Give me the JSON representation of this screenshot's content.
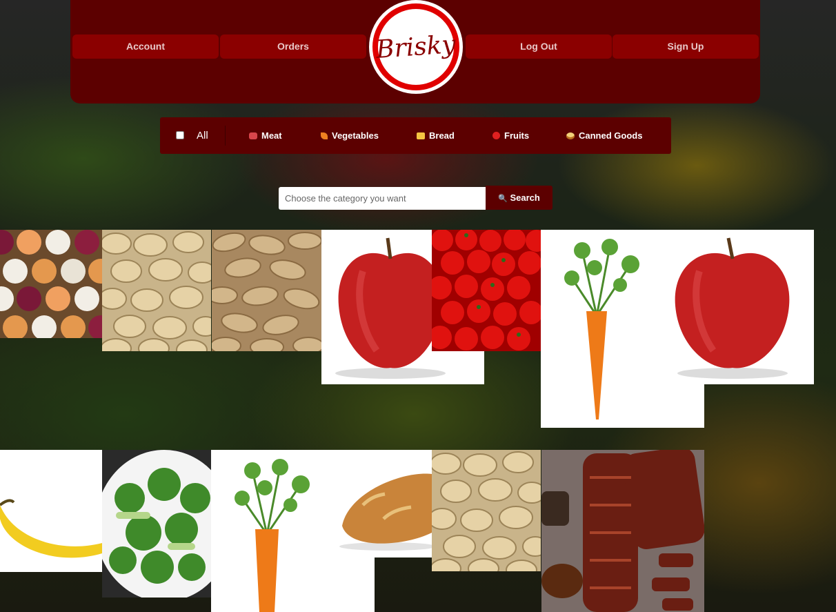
{
  "header": {
    "logo_text": "Brisky",
    "nav": {
      "account": "Account",
      "orders": "Orders",
      "logout": "Log Out",
      "signup": "Sign Up"
    }
  },
  "categories": {
    "all": "All",
    "meat": "Meat",
    "vegetables": "Vegetables",
    "bread": "Bread",
    "fruits": "Fruits",
    "canned": "Canned Goods"
  },
  "search": {
    "placeholder": "Choose the category you want",
    "button": "Search"
  },
  "products": [
    {
      "item": "onions"
    },
    {
      "item": "pistachios"
    },
    {
      "item": "almonds"
    },
    {
      "item": "apple"
    },
    {
      "item": "tomatoes"
    },
    {
      "item": "carrot"
    },
    {
      "item": "apple"
    },
    {
      "item": "banana"
    },
    {
      "item": "broccoli"
    },
    {
      "item": "carrot"
    },
    {
      "item": "bread"
    },
    {
      "item": "pistachios"
    },
    {
      "item": "ribs"
    }
  ],
  "colors": {
    "header_bg": "#5c0000",
    "button_bg": "#8b0000",
    "logo_ring": "#e00000"
  }
}
